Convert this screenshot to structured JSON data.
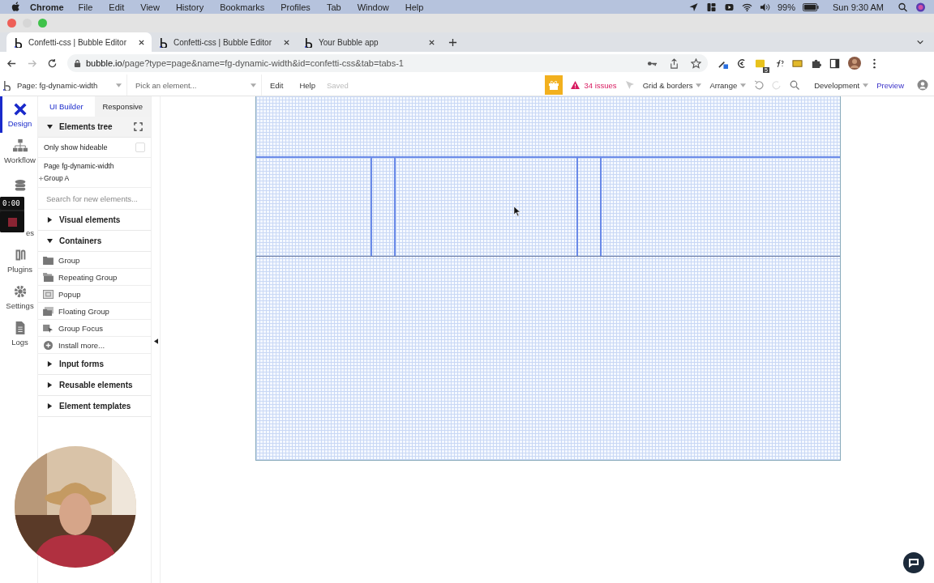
{
  "menu_bar": {
    "app": "Chrome",
    "items": [
      "File",
      "Edit",
      "View",
      "History",
      "Bookmarks",
      "Profiles",
      "Tab",
      "Window",
      "Help"
    ],
    "battery": "99%",
    "clock": "Sun 9:30 AM"
  },
  "tabs": [
    {
      "title": "Confetti-css | Bubble Editor",
      "selected": true
    },
    {
      "title": "Confetti-css | Bubble Editor",
      "selected": false
    },
    {
      "title": "Your Bubble app",
      "selected": false
    }
  ],
  "address": {
    "url": "**bubble.io**/page?type=page&name=fg-dynamic-width&id=confetti-css&tab=tabs-1",
    "extension_badge": "5"
  },
  "toolbar": {
    "page": "Page: fg-dynamic-width",
    "element_picker": {
      "placeholder": "Pick an element..."
    },
    "menus": [
      "Edit",
      "Help"
    ],
    "status": "Saved",
    "issues": "34 issues",
    "grid": "Grid & borders",
    "arrange": "Arrange",
    "mode": "Development",
    "preview": "Preview"
  },
  "nav": [
    {
      "kind": "design",
      "label": "Design",
      "selected": true
    },
    {
      "kind": "workflow",
      "label": "Workflow",
      "selected": false
    },
    {
      "kind": "data",
      "selected": false
    },
    {
      "kind": "styles",
      "label": "es",
      "selected": false
    },
    {
      "kind": "plugins",
      "label": "Plugins",
      "selected": false
    },
    {
      "kind": "settings",
      "label": "Settings",
      "selected": false
    },
    {
      "kind": "logs",
      "label": "Logs",
      "selected": false
    }
  ],
  "panel": {
    "tabs": [
      {
        "label": "UI Builder",
        "selected": true
      },
      {
        "label": "Responsive",
        "selected": false
      }
    ],
    "tree_title": "Elements tree",
    "only_hideable": {
      "label": "Only show hideable",
      "checked": false
    },
    "tree": [
      {
        "label": "Page fg-dynamic-width",
        "children": [
          {
            "label": "Group A"
          }
        ]
      }
    ],
    "search": {
      "placeholder": "Search for new elements..."
    },
    "sections": [
      {
        "title": "Visual elements",
        "expanded": false
      },
      {
        "title": "Containers",
        "expanded": true,
        "items": [
          {
            "kind": "folder",
            "label": "Group"
          },
          {
            "kind": "folders",
            "label": "Repeating Group"
          },
          {
            "kind": "popup",
            "label": "Popup"
          },
          {
            "kind": "floating",
            "label": "Floating Group"
          },
          {
            "kind": "focus",
            "label": "Group Focus"
          },
          {
            "kind": "install",
            "label": "Install more..."
          }
        ]
      },
      {
        "title": "Input forms",
        "expanded": false
      },
      {
        "title": "Reusable elements",
        "expanded": false
      },
      {
        "title": "Element templates",
        "expanded": false
      }
    ]
  },
  "recorder": {
    "time": "0:00"
  }
}
